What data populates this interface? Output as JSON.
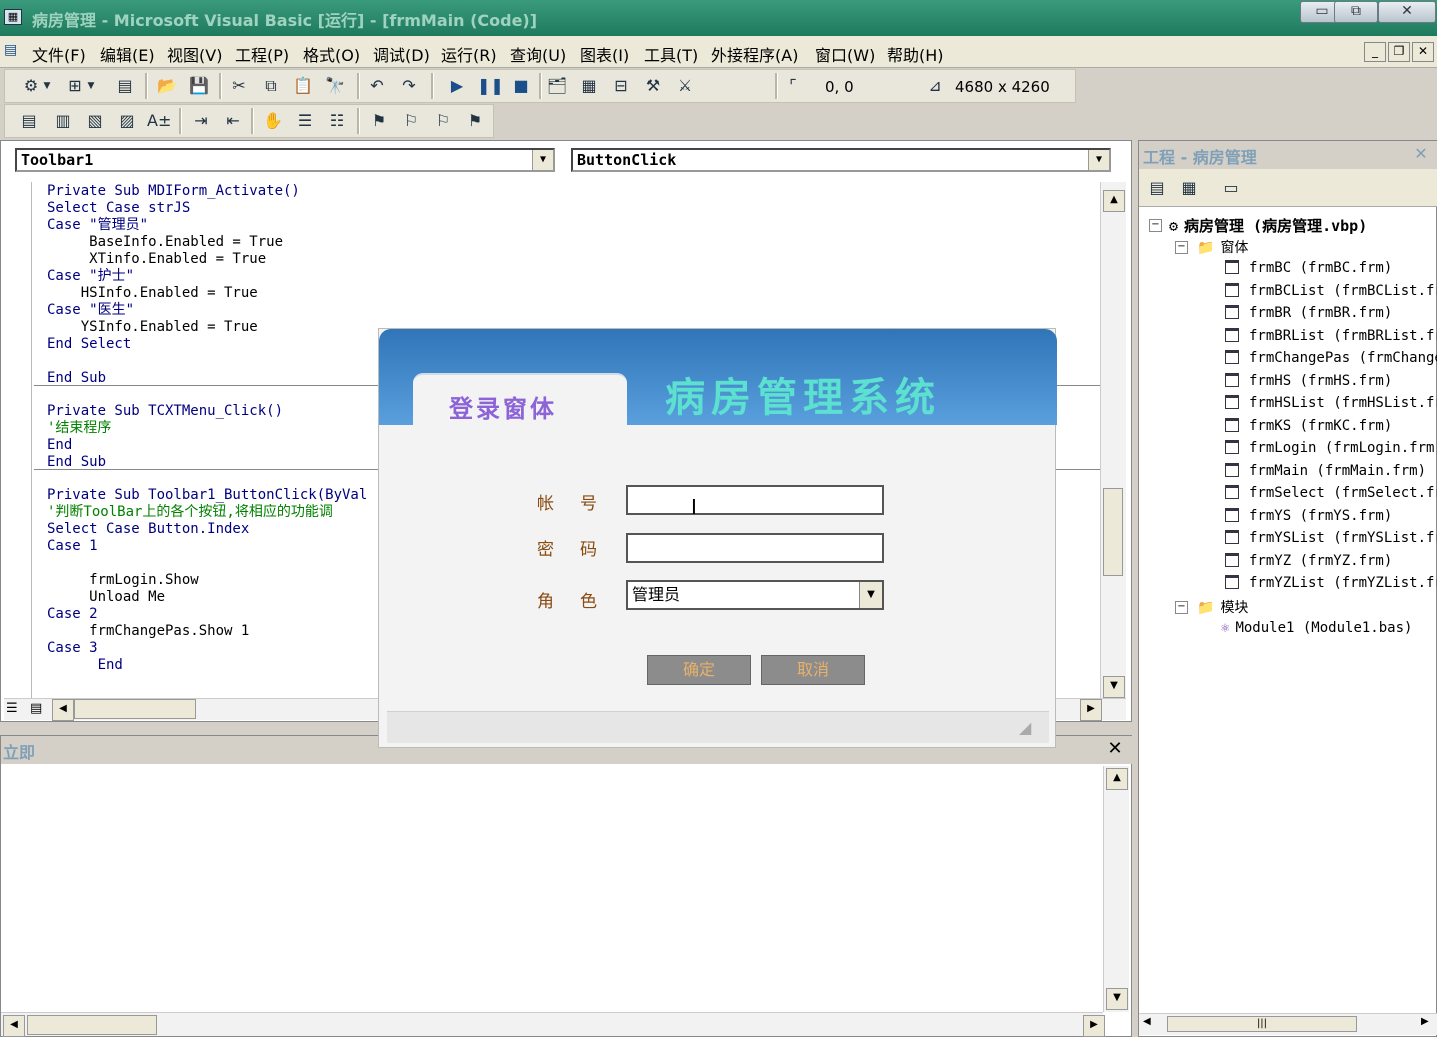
{
  "window": {
    "title": "病房管理 - Microsoft Visual Basic [运行] - [frmMain (Code)]",
    "min_label": "▭",
    "max_label": "⧉",
    "close_label": "✕"
  },
  "menu": [
    "文件(F)",
    "编辑(E)",
    "视图(V)",
    "工程(P)",
    "格式(O)",
    "调试(D)",
    "运行(R)",
    "查询(U)",
    "图表(I)",
    "工具(T)",
    "外接程序(A)",
    "窗口(W)",
    "帮助(H)"
  ],
  "toolbar": {
    "position": "0, 0",
    "size": "4680 x 4260"
  },
  "code_window": {
    "object_combo": "Toolbar1",
    "proc_combo": "ButtonClick"
  },
  "code": {
    "l01": "Private Sub MDIForm_Activate()",
    "l02": "Select Case strJS",
    "l03": "Case \"管理员\"",
    "l04": "     BaseInfo.Enabled = True",
    "l05": "     XTinfo.Enabled = True",
    "l06": "Case \"护士\"",
    "l07": "    HSInfo.Enabled = True",
    "l08": "Case \"医生\"",
    "l09": "    YSInfo.Enabled = True",
    "l10": "End Select",
    "l11": "End Sub",
    "l12": "Private Sub TCXTMenu_Click()",
    "l13": "'结束程序",
    "l14": "End",
    "l15": "End Sub",
    "l16": "Private Sub Toolbar1_ButtonClick(ByVal",
    "l17": "'判断ToolBar上的各个按钮,将相应的功能调",
    "l18": "Select Case Button.Index",
    "l19": "Case 1",
    "l20": "     frmLogin.Show",
    "l21": "     Unload Me",
    "l22": "Case 2",
    "l23": "     frmChangePas.Show 1",
    "l24": "Case 3",
    "l25": "      End"
  },
  "login": {
    "system_title": "病房管理系统",
    "tab_title": "登录窗体",
    "account_label": "帐号",
    "password_label": "密码",
    "role_label": "角色",
    "account_value": "",
    "password_value": "",
    "role_value": "管理员",
    "ok_label": "确定",
    "cancel_label": "取消"
  },
  "project": {
    "title": "工程 - 病房管理",
    "root": "病房管理 (病房管理.vbp)",
    "forms_folder": "窗体",
    "forms": [
      "frmBC (frmBC.frm)",
      "frmBCList (frmBCList.frm)",
      "frmBR (frmBR.frm)",
      "frmBRList (frmBRList.frm)",
      "frmChangePas (frmChangePas.frm)",
      "frmHS (frmHS.frm)",
      "frmHSList (frmHSList.frm)",
      "frmKS (frmKC.frm)",
      "frmLogin (frmLogin.frm)",
      "frmMain (frmMain.frm)",
      "frmSelect (frmSelect.frm)",
      "frmYS (frmYS.frm)",
      "frmYSList (frmYSList.frm)",
      "frmYZ (frmYZ.frm)",
      "frmYZList (frmYZList.frm)"
    ],
    "modules_folder": "模块",
    "modules": [
      "Module1 (Module1.bas)"
    ]
  },
  "immediate": {
    "title": "立即"
  }
}
